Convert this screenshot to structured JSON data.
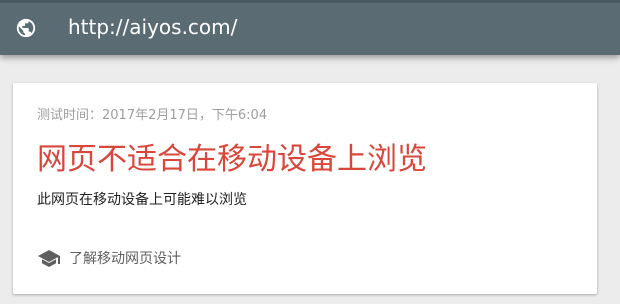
{
  "browser": {
    "url": "http://aiyos.com/",
    "icon": "globe-icon"
  },
  "result": {
    "test_time": "测试时间：2017年2月17日，下午6:04",
    "headline": "网页不适合在移动设备上浏览",
    "subtext": "此网页在移动设备上可能难以浏览",
    "learn_more": "了解移动网页设计",
    "learn_icon": "graduation-cap-icon"
  },
  "colors": {
    "urlbar": "#5a6b74",
    "headline": "#d9463a",
    "background": "#ececec"
  }
}
